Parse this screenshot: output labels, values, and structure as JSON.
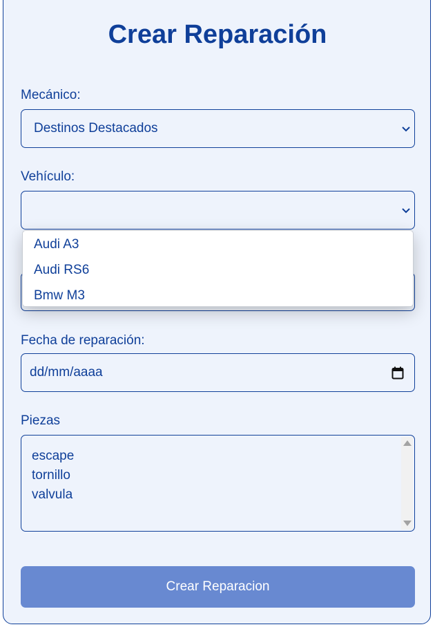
{
  "form": {
    "title": "Crear Reparación",
    "mecanico": {
      "label": "Mecánico:",
      "selected": "Destinos Destacados"
    },
    "vehiculo": {
      "label": "Vehículo:",
      "selected": "",
      "options": [
        "Audi A3",
        "Audi RS6",
        "Bmw M3"
      ]
    },
    "fecha": {
      "label": "Fecha de reparación:",
      "placeholder": "dd/mm/aaaa"
    },
    "piezas": {
      "label": "Piezas",
      "lines": [
        "escape",
        "tornillo",
        "valvula"
      ]
    },
    "submit_label": "Crear Reparacion"
  },
  "icons": {
    "select_arrow": "chevron-down-icon",
    "date_picker": "calendar-icon",
    "scroll_up": "scroll-up-arrow",
    "scroll_down": "scroll-down-arrow"
  },
  "colors": {
    "primary": "#0f3f99",
    "background": "#eef3fc",
    "button": "#6889d1"
  }
}
